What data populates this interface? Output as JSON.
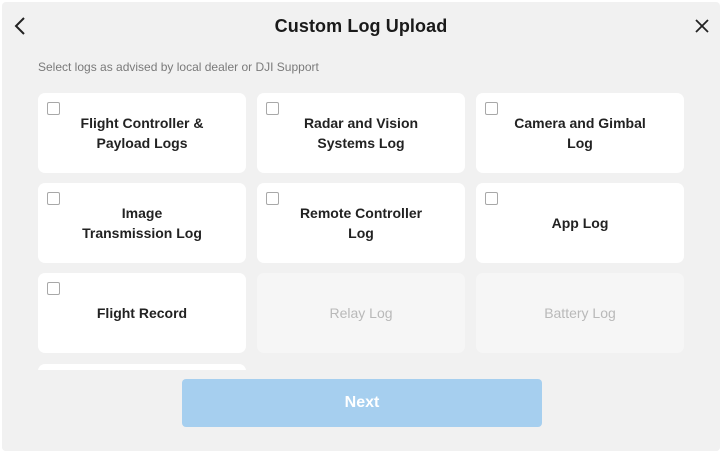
{
  "header": {
    "title": "Custom Log Upload",
    "back_icon": "chevron-left-icon",
    "close_icon": "close-icon"
  },
  "subtitle": "Select logs as advised by local dealer or DJI Support",
  "logs": [
    {
      "label": "Flight Controller &\nPayload Logs",
      "enabled": true,
      "checked": false
    },
    {
      "label": "Radar and Vision\nSystems Log",
      "enabled": true,
      "checked": false
    },
    {
      "label": "Camera and Gimbal\nLog",
      "enabled": true,
      "checked": false
    },
    {
      "label": "Image\nTransmission Log",
      "enabled": true,
      "checked": false
    },
    {
      "label": "Remote Controller\nLog",
      "enabled": true,
      "checked": false
    },
    {
      "label": "App Log",
      "enabled": true,
      "checked": false
    },
    {
      "label": "Flight Record",
      "enabled": true,
      "checked": false
    },
    {
      "label": "Relay Log",
      "enabled": false,
      "checked": false
    },
    {
      "label": "Battery Log",
      "enabled": false,
      "checked": false
    }
  ],
  "footer": {
    "next_label": "Next"
  },
  "colors": {
    "background": "#f1f1f1",
    "card": "#ffffff",
    "disabled_card": "#f6f6f6",
    "next_button": "#a6cfef"
  }
}
